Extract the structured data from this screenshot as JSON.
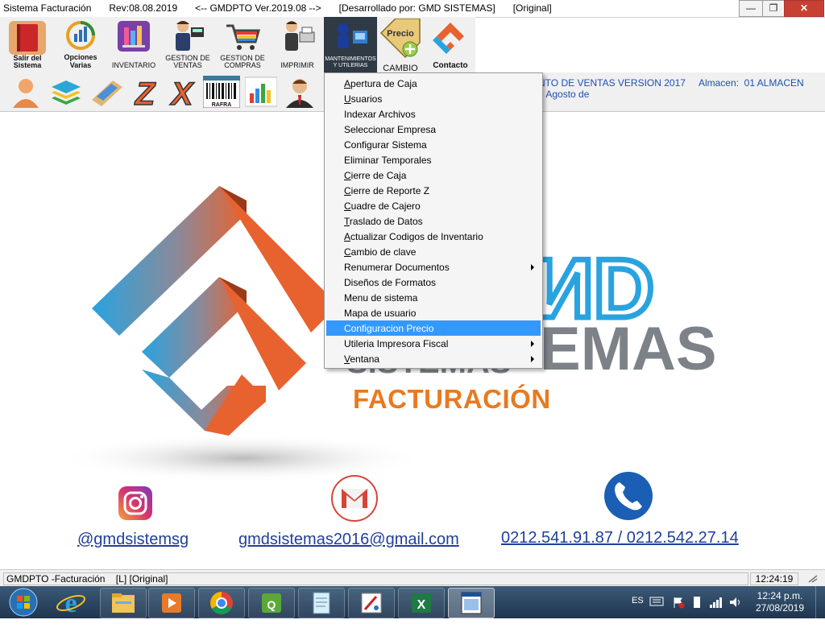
{
  "window": {
    "title_parts": [
      "Sistema Facturación",
      "Rev:08.08.2019",
      "<-- GMDPTO Ver.2019.08 -->",
      "[Desarrollado por: GMD SISTEMAS]",
      "[Original]"
    ]
  },
  "toolbar": {
    "items": [
      {
        "label": "Salir del Sistema",
        "icon": "book-exit-icon"
      },
      {
        "label": "Opciones Varias",
        "icon": "chart-cycle-icon"
      },
      {
        "label": "INVENTARIO",
        "icon": "inventory-books-icon"
      },
      {
        "label": "GESTION DE VENTAS",
        "icon": "salesperson-icon"
      },
      {
        "label": "GESTION DE COMPRAS",
        "icon": "shopping-cart-icon"
      },
      {
        "label": "IMPRIMIR",
        "icon": "printer-person-icon"
      },
      {
        "label": "MANTENIMIENTOS Y UTILERIAS",
        "icon": "maintenance-icon"
      },
      {
        "label": "CAMBIO",
        "icon": "price-tag-icon",
        "tag_text": "Precio"
      },
      {
        "label": "Contacto",
        "icon": "gmd-logo-icon"
      }
    ]
  },
  "secondary_toolbar": {
    "icons": [
      "client-person-icon",
      "layers-icon",
      "cash-register-icon",
      "z-report-icon",
      "x-report-icon",
      "barcode-icon",
      "bar-chart-icon",
      "businessman-icon"
    ],
    "barcode_text": "RAFRA",
    "info_line1": "NTO DE VENTAS VERSION 2017     Almacen:  01 ALMACEN",
    "info_line2": "e Agosto de"
  },
  "menu": {
    "items": [
      {
        "label": "Apertura de Caja",
        "mnemonic": "A",
        "submenu": false,
        "selected": false
      },
      {
        "label": "Usuarios",
        "mnemonic": "U",
        "submenu": false,
        "selected": false
      },
      {
        "label": "Indexar Archivos",
        "mnemonic": "",
        "submenu": false,
        "selected": false
      },
      {
        "label": "Seleccionar Empresa",
        "mnemonic": "",
        "submenu": false,
        "selected": false
      },
      {
        "label": "Configurar Sistema",
        "mnemonic": "",
        "submenu": false,
        "selected": false
      },
      {
        "label": "Eliminar Temporales",
        "mnemonic": "",
        "submenu": false,
        "selected": false
      },
      {
        "label": "Cierre de Caja",
        "mnemonic": "C",
        "submenu": false,
        "selected": false
      },
      {
        "label": "Cierre de Reporte Z",
        "mnemonic": "C",
        "submenu": false,
        "selected": false
      },
      {
        "label": "Cuadre de Cajero",
        "mnemonic": "C",
        "submenu": false,
        "selected": false
      },
      {
        "label": "Traslado de Datos",
        "mnemonic": "T",
        "submenu": false,
        "selected": false
      },
      {
        "label": "Actualizar Codigos de Inventario",
        "mnemonic": "A",
        "submenu": false,
        "selected": false
      },
      {
        "label": "Cambio de clave",
        "mnemonic": "C",
        "submenu": false,
        "selected": false
      },
      {
        "label": "Renumerar Documentos",
        "mnemonic": "",
        "submenu": true,
        "selected": false
      },
      {
        "label": "Diseños de Formatos",
        "mnemonic": "",
        "submenu": false,
        "selected": false
      },
      {
        "label": "Menu de sistema",
        "mnemonic": "",
        "submenu": false,
        "selected": false
      },
      {
        "label": "Mapa de usuario",
        "mnemonic": "",
        "submenu": false,
        "selected": false
      },
      {
        "label": "Configuracion Precio",
        "mnemonic": "",
        "submenu": false,
        "selected": true
      },
      {
        "label": "Utileria Impresora Fiscal",
        "mnemonic": "",
        "submenu": true,
        "selected": false
      },
      {
        "label": "Ventana",
        "mnemonic": "V",
        "submenu": true,
        "selected": false
      }
    ]
  },
  "content": {
    "logo_text_partial_1": "ИD",
    "logo_text_partial_2": "EMAS",
    "logo_text_partial_3": "SISTEMAS",
    "product": "FACTURACIÓN",
    "colors": {
      "orange": "#e8622f",
      "blue": "#29a3e0",
      "product": "#e87a1f",
      "link": "#1f3f9a"
    },
    "contacts": [
      {
        "icon": "instagram-icon",
        "text": "@gmdsistemsg"
      },
      {
        "icon": "gmail-icon",
        "text": "gmdsistemas2016@gmail.com"
      },
      {
        "icon": "phone-icon",
        "text": "0212.541.91.87 / 0212.542.27.14"
      }
    ]
  },
  "statusbar": {
    "text": "GMDPTO -Facturación    [L] [Original]",
    "time": "12:24:19"
  },
  "taskbar": {
    "apps": [
      "file-explorer-icon",
      "media-player-icon",
      "chrome-icon",
      "qv-app-icon",
      "notepad-app-icon",
      "paint-app-icon",
      "excel-icon",
      "facturacion-app-icon"
    ],
    "lang": "ES",
    "time": "12:24 p.m.",
    "date": "27/08/2019"
  }
}
